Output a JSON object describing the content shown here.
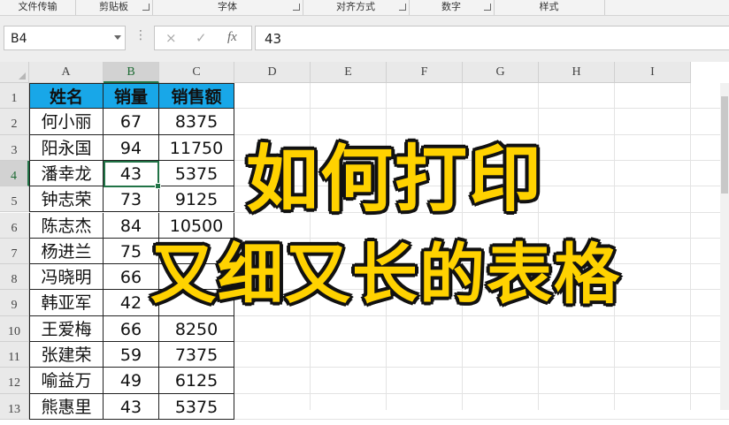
{
  "ribbon": {
    "groups": [
      {
        "label": "文件传输"
      },
      {
        "label": "剪贴板"
      },
      {
        "label": "字体"
      },
      {
        "label": "对齐方式"
      },
      {
        "label": "数字"
      },
      {
        "label": "样式"
      }
    ]
  },
  "formula_bar": {
    "name_box": "B4",
    "cancel_icon": "×",
    "confirm_icon": "✓",
    "fx_label": "fx",
    "value": "43"
  },
  "columns": [
    "A",
    "B",
    "C",
    "D",
    "E",
    "F",
    "G",
    "H",
    "I"
  ],
  "rows": [
    "1",
    "2",
    "3",
    "4",
    "5",
    "6",
    "7",
    "8",
    "9",
    "10",
    "11",
    "12",
    "13"
  ],
  "table": {
    "headers": [
      "姓名",
      "销量",
      "销售额"
    ],
    "rows": [
      [
        "何小丽",
        "67",
        "8375"
      ],
      [
        "阳永国",
        "94",
        "11750"
      ],
      [
        "潘幸龙",
        "43",
        "5375"
      ],
      [
        "钟志荣",
        "73",
        "9125"
      ],
      [
        "陈志杰",
        "84",
        "10500"
      ],
      [
        "杨进兰",
        "75",
        ""
      ],
      [
        "冯晓明",
        "66",
        ""
      ],
      [
        "韩亚军",
        "42",
        ""
      ],
      [
        "王爱梅",
        "66",
        "8250"
      ],
      [
        "张建荣",
        "59",
        "7375"
      ],
      [
        "喻益万",
        "49",
        "6125"
      ],
      [
        "熊惠里",
        "43",
        "5375"
      ]
    ]
  },
  "overlay": {
    "line1": "如何打印",
    "line2": "又细又长的表格"
  },
  "colors": {
    "header_fill": "#18a7e8",
    "selection": "#217346",
    "overlay_text": "#ffd200"
  }
}
